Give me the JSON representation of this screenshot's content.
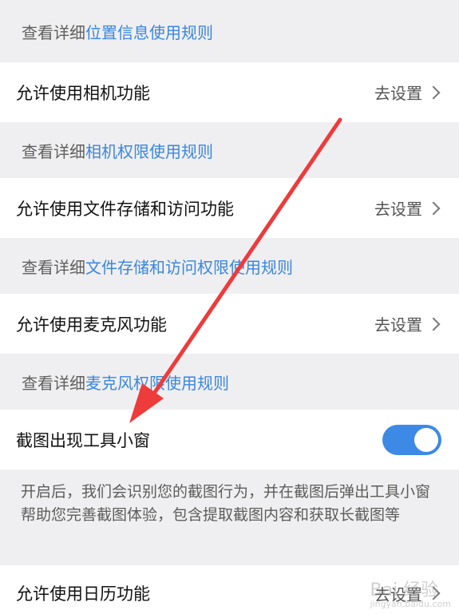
{
  "notes": {
    "location": {
      "prefix": "查看详细",
      "link": "位置信息使用规则"
    },
    "camera": {
      "prefix": "查看详细",
      "link": "相机权限使用规则"
    },
    "storage": {
      "prefix": "查看详细",
      "link": "文件存储和访问权限使用规则"
    },
    "mic": {
      "prefix": "查看详细",
      "link": "麦克风权限使用规则"
    }
  },
  "rows": {
    "camera": {
      "label": "允许使用相机功能",
      "action": "去设置"
    },
    "storage": {
      "label": "允许使用文件存储和访问功能",
      "action": "去设置"
    },
    "mic": {
      "label": "允许使用麦克风功能",
      "action": "去设置"
    },
    "screenshot": {
      "label": "截图出现工具小窗",
      "enabled": true
    },
    "calendar": {
      "label": "允许使用日历功能",
      "action": "去设置"
    }
  },
  "screenshot_desc": "开启后，我们会识别您的截图行为，并在截图后弹出工具小窗帮助您完善截图体验，包含提取截图内容和获取长截图等",
  "colors": {
    "link": "#3a86e0",
    "toggle_on": "#3c8ae5",
    "annotation_arrow": "#ee3b3b",
    "background": "#efeff1"
  },
  "watermark": {
    "text": "Bai 经验",
    "sub": "jingyan.baidu.com"
  }
}
